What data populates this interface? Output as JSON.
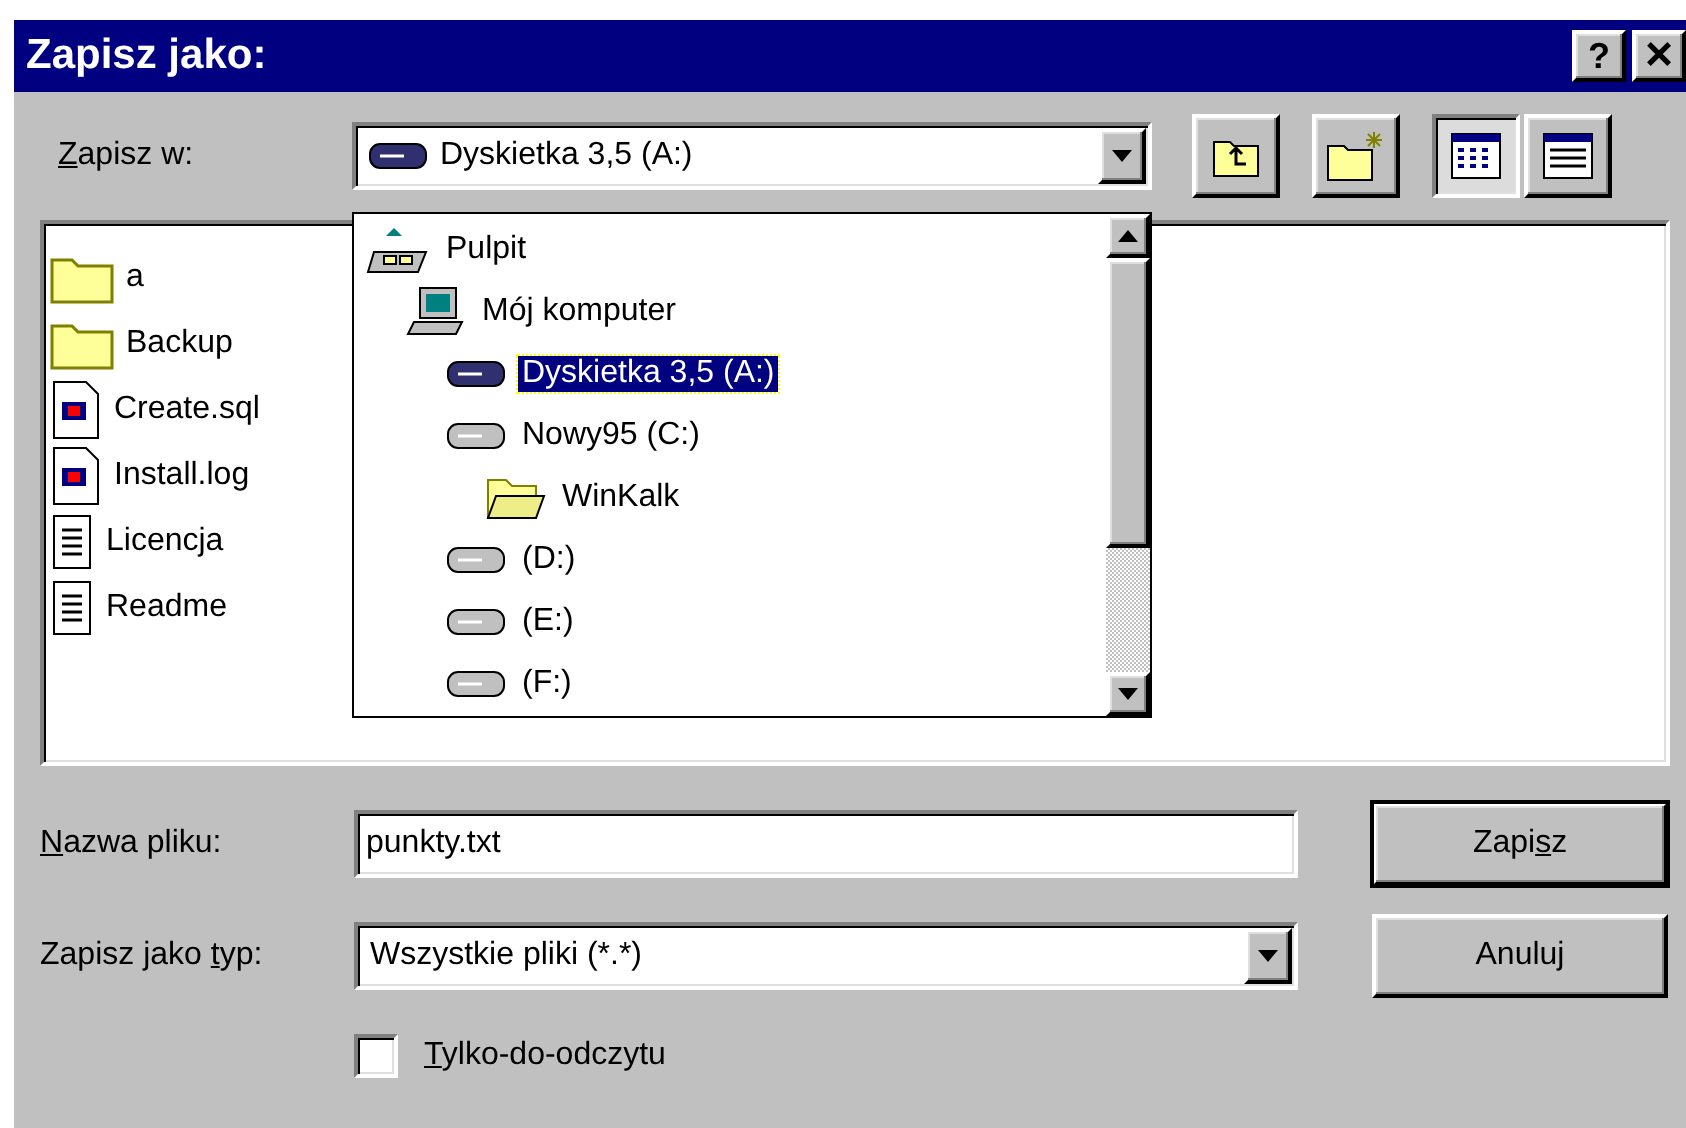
{
  "window": {
    "title": "Zapisz jako:",
    "buttons": [
      {
        "kind": "help",
        "label": "?"
      },
      {
        "kind": "close",
        "label": "×"
      }
    ]
  },
  "save_in": {
    "label": {
      "key": "Z",
      "after": "apisz w:"
    },
    "value": "Dyskietka 3,5 (A:)",
    "kind": "floppy"
  },
  "toolbar": {
    "buttons": [
      {
        "kind": "up-folder"
      },
      {
        "kind": "new-folder"
      }
    ],
    "views": [
      {
        "kind": "list",
        "selected": true
      },
      {
        "kind": "details",
        "selected": false
      }
    ]
  },
  "dropdown": {
    "items": [
      {
        "label": "Pulpit",
        "kind": "desktop",
        "selected": false,
        "children": [
          {
            "label": "Mój komputer",
            "kind": "computer",
            "selected": false,
            "children": [
              {
                "label": "Dyskietka 3,5 (A:)",
                "kind": "floppy",
                "selected": true
              },
              {
                "label": "Nowy95 (C:)",
                "kind": "drive",
                "selected": false,
                "children": [
                  {
                    "label": "WinKalk",
                    "kind": "open-folder",
                    "selected": false
                  }
                ]
              },
              {
                "label": "(D:)",
                "kind": "drive",
                "selected": false
              },
              {
                "label": "(E:)",
                "kind": "drive",
                "selected": false
              },
              {
                "label": "(F:)",
                "kind": "drive",
                "selected": false
              }
            ]
          }
        ]
      }
    ]
  },
  "files": [
    {
      "name": "a",
      "kind": "folder"
    },
    {
      "name": "Backup",
      "kind": "folder"
    },
    {
      "name": "Create.sql",
      "kind": "script"
    },
    {
      "name": "Install.log",
      "kind": "script"
    },
    {
      "name": "Licencja",
      "kind": "text"
    },
    {
      "name": "Readme",
      "kind": "text"
    }
  ],
  "file_name": {
    "label": {
      "key": "N",
      "after": "azwa pliku:"
    },
    "value": "punkty.txt"
  },
  "file_type": {
    "label": {
      "before": "Zapisz jako ",
      "key": "t",
      "after": "yp:"
    },
    "value": "Wszystkie pliki (*.*)"
  },
  "buttons": [
    {
      "label": {
        "before": "Zapi",
        "key": "s",
        "after": "z"
      },
      "default": true
    },
    {
      "label": {
        "before": "Anuluj"
      },
      "default": false
    }
  ],
  "read_only": {
    "label": {
      "key": "T",
      "after": "ylko-do-odczytu"
    },
    "checked": false
  }
}
